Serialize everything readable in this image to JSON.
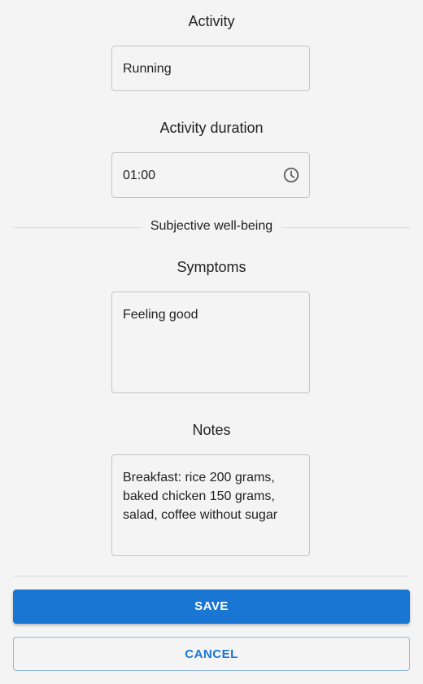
{
  "activity": {
    "label": "Activity",
    "value": "Running"
  },
  "duration": {
    "label": "Activity duration",
    "value": "01:00",
    "icon": "clock-icon"
  },
  "wellbeing": {
    "divider_label": "Subjective well-being"
  },
  "symptoms": {
    "label": "Symptoms",
    "value": "Feeling good"
  },
  "notes": {
    "label": "Notes",
    "value": "Breakfast: rice 200 grams,\nbaked chicken 150 grams,\nsalad, coffee without sugar"
  },
  "actions": {
    "save_label": "SAVE",
    "cancel_label": "CANCEL"
  },
  "colors": {
    "primary": "#1976d2",
    "background": "#f4f4f4",
    "border": "#c4c4c4"
  }
}
